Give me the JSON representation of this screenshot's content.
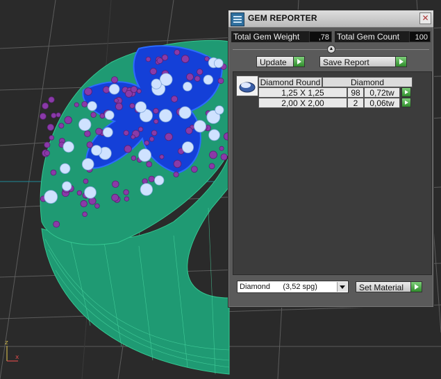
{
  "viewport": {
    "axis": {
      "x": "x",
      "z": "z"
    }
  },
  "panel": {
    "title": "GEM REPORTER",
    "close_glyph": "✕",
    "total_weight": {
      "label": "Total Gem Weight",
      "value": ",78"
    },
    "total_count": {
      "label": "Total Gem Count",
      "value": "100"
    },
    "buttons": {
      "update": "Update",
      "save_report": "Save Report",
      "set_material": "Set Material"
    },
    "table": {
      "headers": [
        "Diamond Round",
        "Diamond"
      ],
      "rows": [
        {
          "size": "1,25 X 1,25",
          "count": "98",
          "weight": "0,72tw"
        },
        {
          "size": "2,00 X 2,00",
          "count": "2",
          "weight": "0,06tw"
        }
      ]
    },
    "material": {
      "selected": "Diamond      (3,52 spg)"
    },
    "icons": {
      "title": "gem-reporter-app-icon",
      "close": "close-icon",
      "collapse": "chevron-up-icon",
      "go": "play-arrow-icon",
      "gem": "round-gem-icon",
      "dropdown": "chevron-down-icon"
    },
    "colors": {
      "go_button": "#2f8c2b",
      "panel_bg": "#5a5a5a",
      "report_bg": "#3c3c3c"
    }
  }
}
